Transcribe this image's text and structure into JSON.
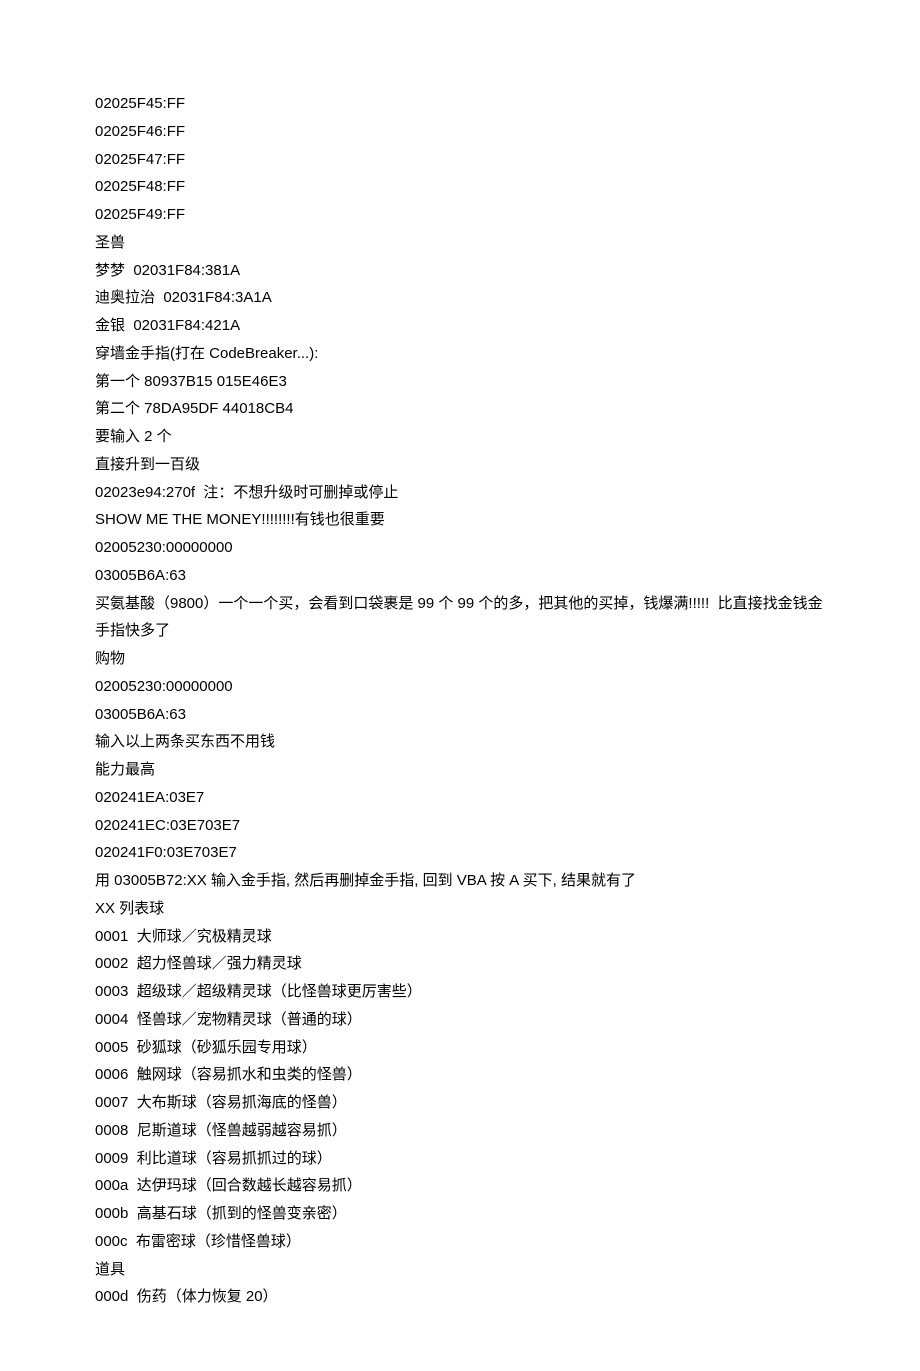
{
  "lines": [
    "02025F45:FF",
    "02025F46:FF",
    "02025F47:FF",
    "02025F48:FF",
    "02025F49:FF",
    "圣兽",
    "梦梦  02031F84:381A",
    "迪奥拉治  02031F84:3A1A",
    "金银  02031F84:421A",
    "穿墙金手指(打在 CodeBreaker...):",
    "第一个 80937B15 015E46E3",
    "第二个 78DA95DF 44018CB4",
    "要输入 2 个",
    "直接升到一百级",
    "02023e94:270f  注：不想升级时可删掉或停止",
    "SHOW ME THE MONEY!!!!!!!!有钱也很重要",
    "02005230:00000000",
    "03005B6A:63",
    "买氨基酸（9800）一个一个买，会看到口袋裹是 99 个 99 个的多，把其他的买掉，钱爆满!!!!!  比直接找金钱金手指快多了",
    "购物",
    "02005230:00000000",
    "03005B6A:63",
    "输入以上两条买东西不用钱",
    "能力最高",
    "020241EA:03E7",
    "020241EC:03E703E7",
    "020241F0:03E703E7",
    "用 03005B72:XX 输入金手指, 然后再删掉金手指, 回到 VBA 按 A 买下, 结果就有了",
    "XX 列表球",
    "0001  大师球／究极精灵球",
    "0002  超力怪兽球／强力精灵球",
    "0003  超级球／超级精灵球（比怪兽球更厉害些）",
    "0004  怪兽球／宠物精灵球（普通的球）",
    "0005  砂狐球（砂狐乐园专用球）",
    "0006  触网球（容易抓水和虫类的怪兽）",
    "0007  大布斯球（容易抓海底的怪兽）",
    "0008  尼斯道球（怪兽越弱越容易抓）",
    "0009  利比道球（容易抓抓过的球）",
    "000a  达伊玛球（回合数越长越容易抓）",
    "000b  高基石球（抓到的怪兽变亲密）",
    "000c  布雷密球（珍惜怪兽球）",
    "道具",
    "000d  伤药（体力恢复 20）"
  ]
}
